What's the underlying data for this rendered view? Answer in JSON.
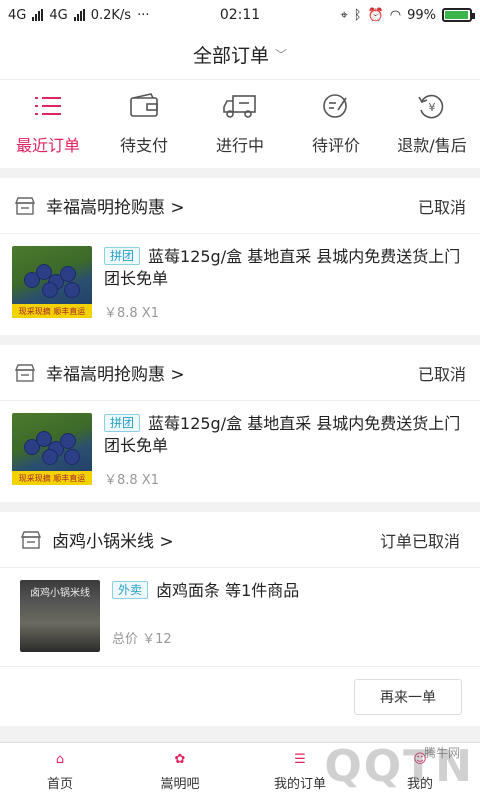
{
  "status_bar": {
    "net1": "4G",
    "net2": "4G",
    "speed": "0.2K/s",
    "dots": "···",
    "time": "02:11",
    "battery": "99%"
  },
  "header": {
    "title": "全部订单"
  },
  "tabs": [
    {
      "label": "最近订单",
      "icon": "list-icon",
      "active": true
    },
    {
      "label": "待支付",
      "icon": "wallet-icon",
      "active": false
    },
    {
      "label": "进行中",
      "icon": "truck-icon",
      "active": false
    },
    {
      "label": "待评价",
      "icon": "review-icon",
      "active": false
    },
    {
      "label": "退款/售后",
      "icon": "refund-icon",
      "active": false
    }
  ],
  "orders": [
    {
      "shop": "幸福嵩明抢购惠 >",
      "status": "已取消",
      "tag": "拼团",
      "title": "蓝莓125g/盒 基地直采 县城内免费送货上门 团长免单",
      "price": "￥8.8 X1",
      "thumb_caption": "现采现摘 顺丰直运"
    },
    {
      "shop": "幸福嵩明抢购惠 >",
      "status": "已取消",
      "tag": "拼团",
      "title": "蓝莓125g/盒 基地直采 县城内免费送货上门 团长免单",
      "price": "￥8.8 X1",
      "thumb_caption": "现采现摘 顺丰直运"
    },
    {
      "shop": "卤鸡小锅米线 >",
      "status": "订单已取消",
      "tag": "外卖",
      "title": "卤鸡面条 等1件商品",
      "price": "总价 ￥12",
      "thumb_caption": "卤鸡小锅米线",
      "reorder": "再来一单"
    }
  ],
  "bottom_nav": [
    {
      "label": "首页",
      "icon": "home-icon"
    },
    {
      "label": "嵩明吧",
      "icon": "community-icon"
    },
    {
      "label": "我的订单",
      "icon": "orders-icon"
    },
    {
      "label": "我的",
      "icon": "profile-icon"
    }
  ],
  "watermark": {
    "text": "QQTN",
    "small": "腾牛网"
  },
  "colors": {
    "accent": "#e0245e",
    "tag": "#2aa0c8",
    "battery": "#3bb54a"
  }
}
